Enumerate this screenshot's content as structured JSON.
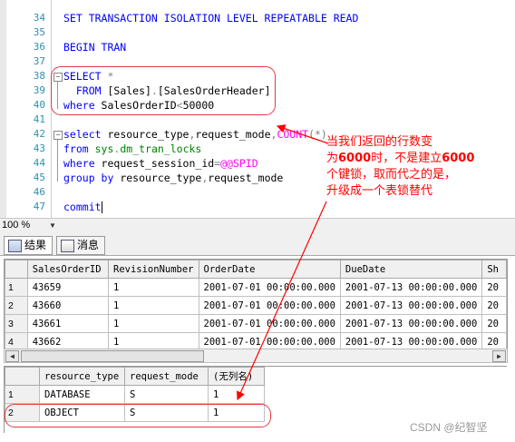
{
  "editor": {
    "lines": [
      {
        "num": "34",
        "parts": [
          {
            "t": "SET TRANSACTION ISOLATION LEVEL REPEATABLE READ",
            "c": "kw"
          }
        ]
      },
      {
        "num": "35",
        "parts": []
      },
      {
        "num": "36",
        "parts": [
          {
            "t": "BEGIN TRAN",
            "c": "kw"
          }
        ]
      },
      {
        "num": "37",
        "parts": []
      },
      {
        "num": "38",
        "parts": [
          {
            "t": "SELECT",
            "c": "kw"
          },
          {
            "t": " *",
            "c": "gray"
          }
        ]
      },
      {
        "num": "39",
        "parts": [
          {
            "t": "  FROM ",
            "c": "kw"
          },
          {
            "t": "[Sales]",
            "c": "blk"
          },
          {
            "t": ".",
            "c": "gray"
          },
          {
            "t": "[SalesOrderHeader]",
            "c": "blk"
          }
        ]
      },
      {
        "num": "40",
        "parts": [
          {
            "t": "where ",
            "c": "kw"
          },
          {
            "t": "SalesOrderID",
            "c": "blk"
          },
          {
            "t": "<",
            "c": "gray"
          },
          {
            "t": "50000",
            "c": "blk"
          }
        ]
      },
      {
        "num": "41",
        "parts": []
      },
      {
        "num": "42",
        "parts": [
          {
            "t": "select ",
            "c": "kw"
          },
          {
            "t": "resource_type",
            "c": "blk"
          },
          {
            "t": ",",
            "c": "gray"
          },
          {
            "t": "request_mode",
            "c": "blk"
          },
          {
            "t": ",",
            "c": "gray"
          },
          {
            "t": "COUNT",
            "c": "mag"
          },
          {
            "t": "(*)",
            "c": "gray"
          }
        ]
      },
      {
        "num": "43",
        "parts": [
          {
            "t": "from ",
            "c": "kw"
          },
          {
            "t": "sys",
            "c": "green"
          },
          {
            "t": ".",
            "c": "gray"
          },
          {
            "t": "dm_tran_locks",
            "c": "green"
          }
        ]
      },
      {
        "num": "44",
        "parts": [
          {
            "t": "where ",
            "c": "kw"
          },
          {
            "t": "request_session_id",
            "c": "blk"
          },
          {
            "t": "=",
            "c": "gray"
          },
          {
            "t": "@@SPID",
            "c": "mag"
          }
        ]
      },
      {
        "num": "45",
        "parts": [
          {
            "t": "group by ",
            "c": "kw"
          },
          {
            "t": "resource_type",
            "c": "blk"
          },
          {
            "t": ",",
            "c": "gray"
          },
          {
            "t": "request_mode",
            "c": "blk"
          }
        ]
      },
      {
        "num": "46",
        "parts": []
      },
      {
        "num": "47",
        "parts": [
          {
            "t": "commit",
            "c": "kw"
          }
        ]
      }
    ]
  },
  "zoom": "100 %",
  "tabs": {
    "results": "结果",
    "messages": "消息"
  },
  "grid1": {
    "columns": [
      "SalesOrderID",
      "RevisionNumber",
      "OrderDate",
      "DueDate",
      "Sh"
    ],
    "rows": [
      {
        "rownum": "1",
        "cells": [
          "43659",
          "1",
          "2001-07-01 00:00:00.000",
          "2001-07-13 00:00:00.000",
          "20"
        ]
      },
      {
        "rownum": "2",
        "cells": [
          "43660",
          "1",
          "2001-07-01 00:00:00.000",
          "2001-07-13 00:00:00.000",
          "20"
        ]
      },
      {
        "rownum": "3",
        "cells": [
          "43661",
          "1",
          "2001-07-01 00:00:00.000",
          "2001-07-13 00:00:00.000",
          "20"
        ]
      },
      {
        "rownum": "4",
        "cells": [
          "43662",
          "1",
          "2001-07-01 00:00:00.000",
          "2001-07-13 00:00:00.000",
          "20"
        ]
      }
    ]
  },
  "grid2": {
    "columns": [
      "resource_type",
      "request_mode",
      "(无列名)"
    ],
    "rows": [
      {
        "rownum": "1",
        "cells": [
          "DATABASE",
          "S",
          "1"
        ]
      },
      {
        "rownum": "2",
        "cells": [
          "OBJECT",
          "S",
          "1"
        ]
      }
    ]
  },
  "annotation": {
    "line1": "当我们返回的行数变",
    "line2_pre": "为",
    "line2_num1": "6000",
    "line2_mid": "时，不是建立",
    "line2_num2": "6000",
    "line3": "个键锁，取而代之的是，",
    "line4": "升级成一个表锁替代",
    "color": "#ff0000"
  },
  "watermark": "CSDN @纪智坚"
}
